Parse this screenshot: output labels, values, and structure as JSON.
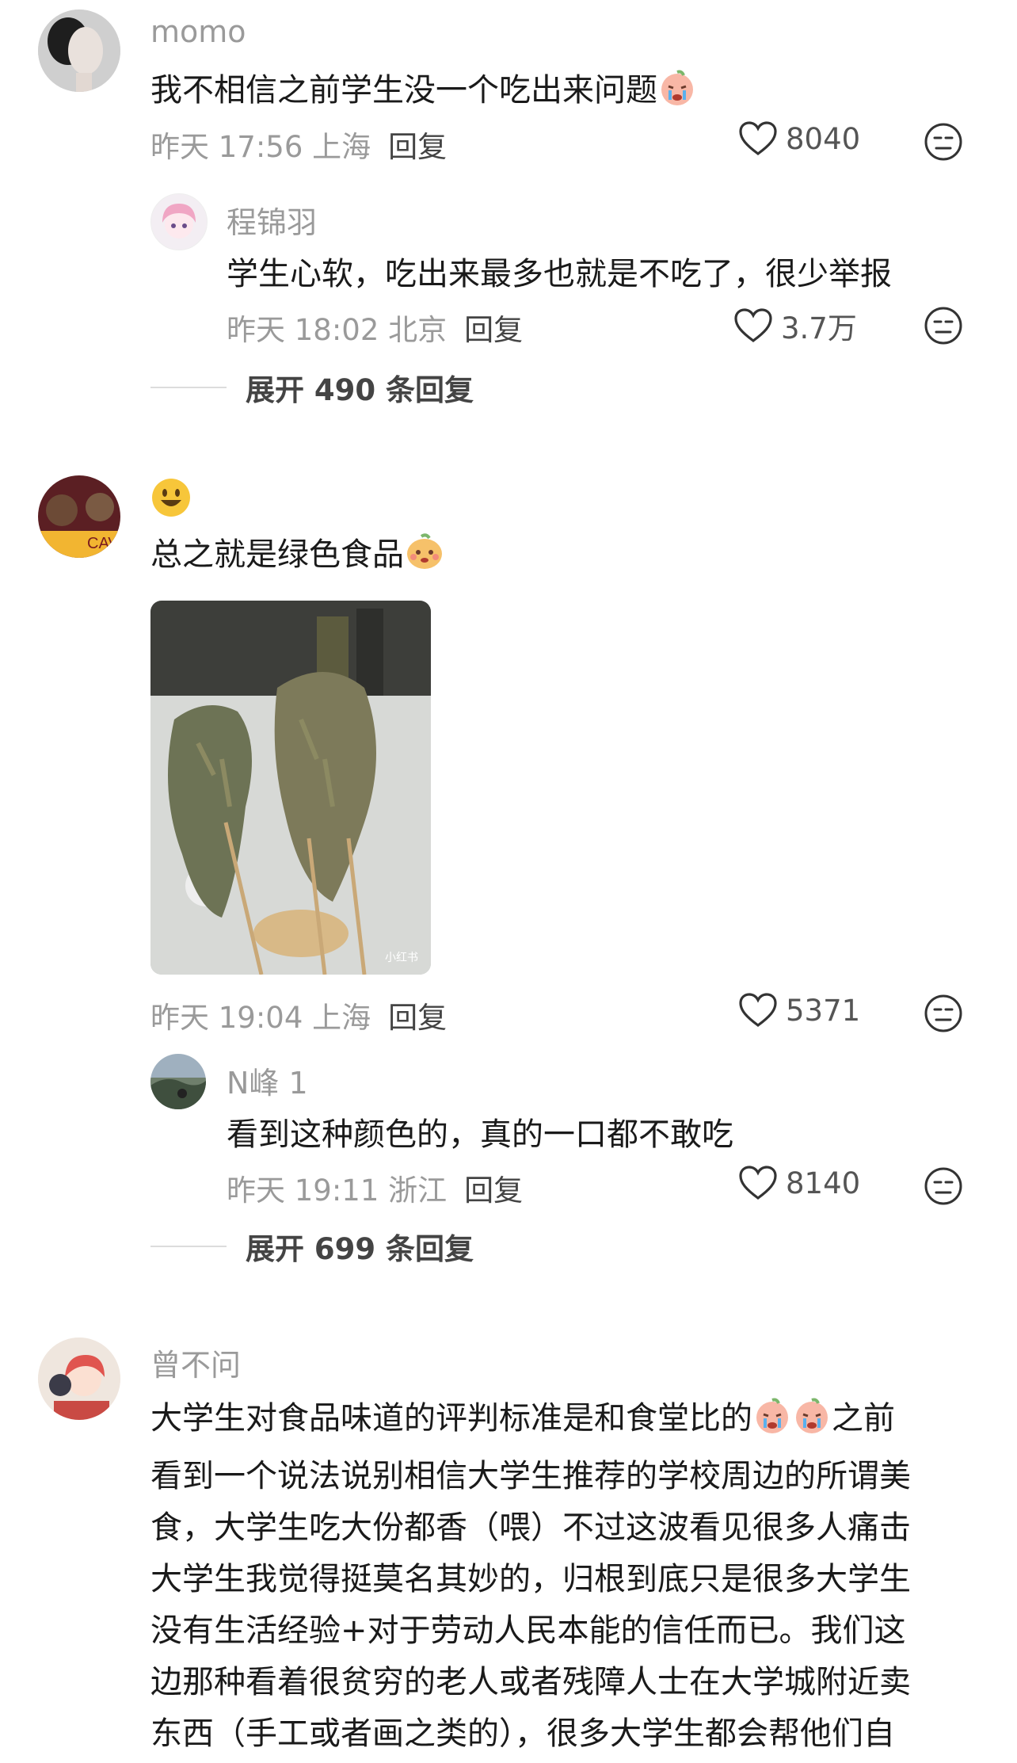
{
  "comments": [
    {
      "username": "momo",
      "text": "我不相信之前学生没一个吃出来问题",
      "time": "昨天 17:56 上海",
      "reply_label": "回复",
      "likes": "8040",
      "replies": [
        {
          "username": "程锦羽",
          "text": "学生心软，吃出来最多也就是不吃了，很少举报",
          "time": "昨天 18:02 北京",
          "reply_label": "回复",
          "likes": "3.7万"
        }
      ],
      "expand_label": "展开 490 条回复"
    },
    {
      "username": "",
      "text": "总之就是绿色食品",
      "image_watermark": "小红书",
      "time": "昨天 19:04 上海",
      "reply_label": "回复",
      "likes": "5371",
      "replies": [
        {
          "username": "N峰 1",
          "text": "看到这种颜色的，真的一口都不敢吃",
          "time": "昨天 19:11 浙江",
          "reply_label": "回复",
          "likes": "8140"
        }
      ],
      "expand_label": "展开 699 条回复"
    },
    {
      "username": "曾不问",
      "lines": [
        "大学生对食品味道的评判标准是和食堂比的",
        "之前",
        "看到一个说法说别相信大学生推荐的学校周边的所谓美",
        "食，大学生吃大份都香（喂）不过这波看见很多人痛击",
        "大学生我觉得挺莫名其妙的，归根到底只是很多大学生",
        "没有生活经验+对于劳动人民本能的信任而已。我们这",
        "边那种看着很贫穷的老人或者残障人士在大学城附近卖",
        "东西（手工或者画之类的），很多大学生都会帮他们自"
      ]
    }
  ],
  "icons": {
    "like": "heart-outline-icon",
    "dislike": "neutral-face-icon",
    "cry": "crying-emoji",
    "grin": "smiley-emoji"
  }
}
